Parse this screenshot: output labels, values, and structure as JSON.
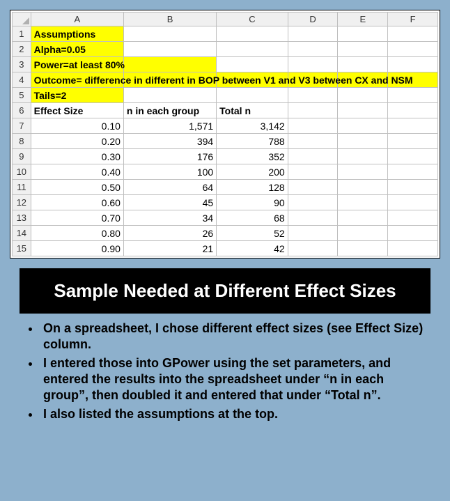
{
  "sheet": {
    "columns": [
      "A",
      "B",
      "C",
      "D",
      "E",
      "F"
    ],
    "assumption_rows": [
      {
        "num": "1",
        "a": "Assumptions",
        "highlight_cols": 1
      },
      {
        "num": "2",
        "a": "Alpha=0.05",
        "highlight_cols": 1
      },
      {
        "num": "3",
        "a": "Power=at least 80%",
        "highlight_cols": 2
      },
      {
        "num": "4",
        "a": "Outcome= difference in different in BOP between V1 and V3 between CX and NSM",
        "highlight_cols": 6
      },
      {
        "num": "5",
        "a": "Tails=2",
        "highlight_cols": 1
      }
    ],
    "header_row": {
      "num": "6",
      "a": "Effect Size",
      "b": "n in each group",
      "c": "Total n"
    },
    "data_rows": [
      {
        "num": "7",
        "a": "0.10",
        "b": "1,571",
        "c": "3,142"
      },
      {
        "num": "8",
        "a": "0.20",
        "b": "394",
        "c": "788"
      },
      {
        "num": "9",
        "a": "0.30",
        "b": "176",
        "c": "352"
      },
      {
        "num": "10",
        "a": "0.40",
        "b": "100",
        "c": "200"
      },
      {
        "num": "11",
        "a": "0.50",
        "b": "64",
        "c": "128"
      },
      {
        "num": "12",
        "a": "0.60",
        "b": "45",
        "c": "90"
      },
      {
        "num": "13",
        "a": "0.70",
        "b": "34",
        "c": "68"
      },
      {
        "num": "14",
        "a": "0.80",
        "b": "26",
        "c": "52"
      },
      {
        "num": "15",
        "a": "0.90",
        "b": "21",
        "c": "42"
      }
    ]
  },
  "title": "Sample Needed at Different Effect Sizes",
  "bullets": [
    "On a spreadsheet, I chose different effect sizes (see Effect Size) column.",
    "I entered those into GPower using the set parameters, and entered the results into the spreadsheet under “n in each group”, then doubled it and entered that under “Total n”.",
    "I also listed the assumptions at the top."
  ],
  "chart_data": {
    "type": "table",
    "title": "Sample Needed at Different Effect Sizes",
    "assumptions": {
      "alpha": 0.05,
      "power": "at least 80%",
      "outcome": "difference in different in BOP between V1 and V3 between CX and NSM",
      "tails": 2
    },
    "columns": [
      "Effect Size",
      "n in each group",
      "Total n"
    ],
    "effect_size": [
      0.1,
      0.2,
      0.3,
      0.4,
      0.5,
      0.6,
      0.7,
      0.8,
      0.9
    ],
    "n_each_group": [
      1571,
      394,
      176,
      100,
      64,
      45,
      34,
      26,
      21
    ],
    "total_n": [
      3142,
      788,
      352,
      200,
      128,
      90,
      68,
      52,
      42
    ]
  }
}
